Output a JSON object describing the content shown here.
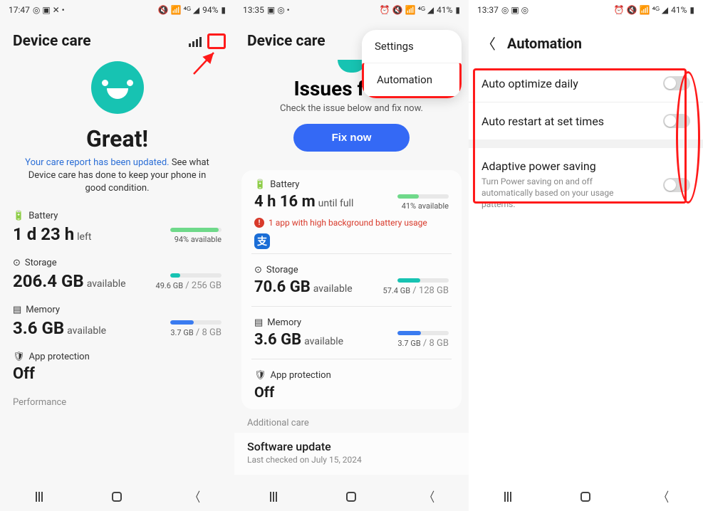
{
  "pane1": {
    "status": {
      "time": "17:47",
      "battery": "94%"
    },
    "title": "Device care",
    "great": "Great!",
    "subLink": "Your care report has been updated.",
    "subRest": " See what Device care has done to keep your phone in good condition.",
    "battery": {
      "label": "Battery",
      "value": "1 d 23 h",
      "unit": "left",
      "avail": "94% available",
      "pct": 94
    },
    "storage": {
      "label": "Storage",
      "value": "206.4 GB",
      "unit": "available",
      "avail": "49.6 GB",
      "total": " / 256 GB",
      "pct": 19
    },
    "memory": {
      "label": "Memory",
      "value": "3.6 GB",
      "unit": "available",
      "avail": "3.7 GB",
      "total": " / 8 GB",
      "pct": 46
    },
    "approt": {
      "label": "App protection",
      "value": "Off"
    },
    "perf": "Performance"
  },
  "pane2": {
    "status": {
      "time": "13:35",
      "battery": "41%"
    },
    "title": "Device care",
    "menu": {
      "settings": "Settings",
      "automation": "Automation"
    },
    "issues": {
      "title": "Issues found",
      "sub": "Check the issue below and fix now.",
      "btn": "Fix now"
    },
    "battery": {
      "label": "Battery",
      "value": "4 h 16 m",
      "unit": "until full",
      "avail": "41% available",
      "pct": 41
    },
    "warn": "1 app with high background battery usage",
    "appGlyph": "支",
    "storage": {
      "label": "Storage",
      "value": "70.6 GB",
      "unit": "available",
      "avail": "57.4 GB",
      "total": " / 128 GB",
      "pct": 45
    },
    "memory": {
      "label": "Memory",
      "value": "3.6 GB",
      "unit": "available",
      "avail": "3.7 GB",
      "total": " / 8 GB",
      "pct": 46
    },
    "approt": {
      "label": "App protection",
      "value": "Off"
    },
    "addl": "Additional care",
    "sw": {
      "title": "Software update",
      "sub": "Last checked on July 15, 2024"
    }
  },
  "pane3": {
    "status": {
      "time": "13:37",
      "battery": "41%"
    },
    "title": "Automation",
    "rows": [
      {
        "t": "Auto optimize daily",
        "s": ""
      },
      {
        "t": "Auto restart at set times",
        "s": ""
      },
      {
        "t": "Adaptive power saving",
        "s": "Turn Power saving on and off automatically based on your usage patterns."
      }
    ]
  }
}
